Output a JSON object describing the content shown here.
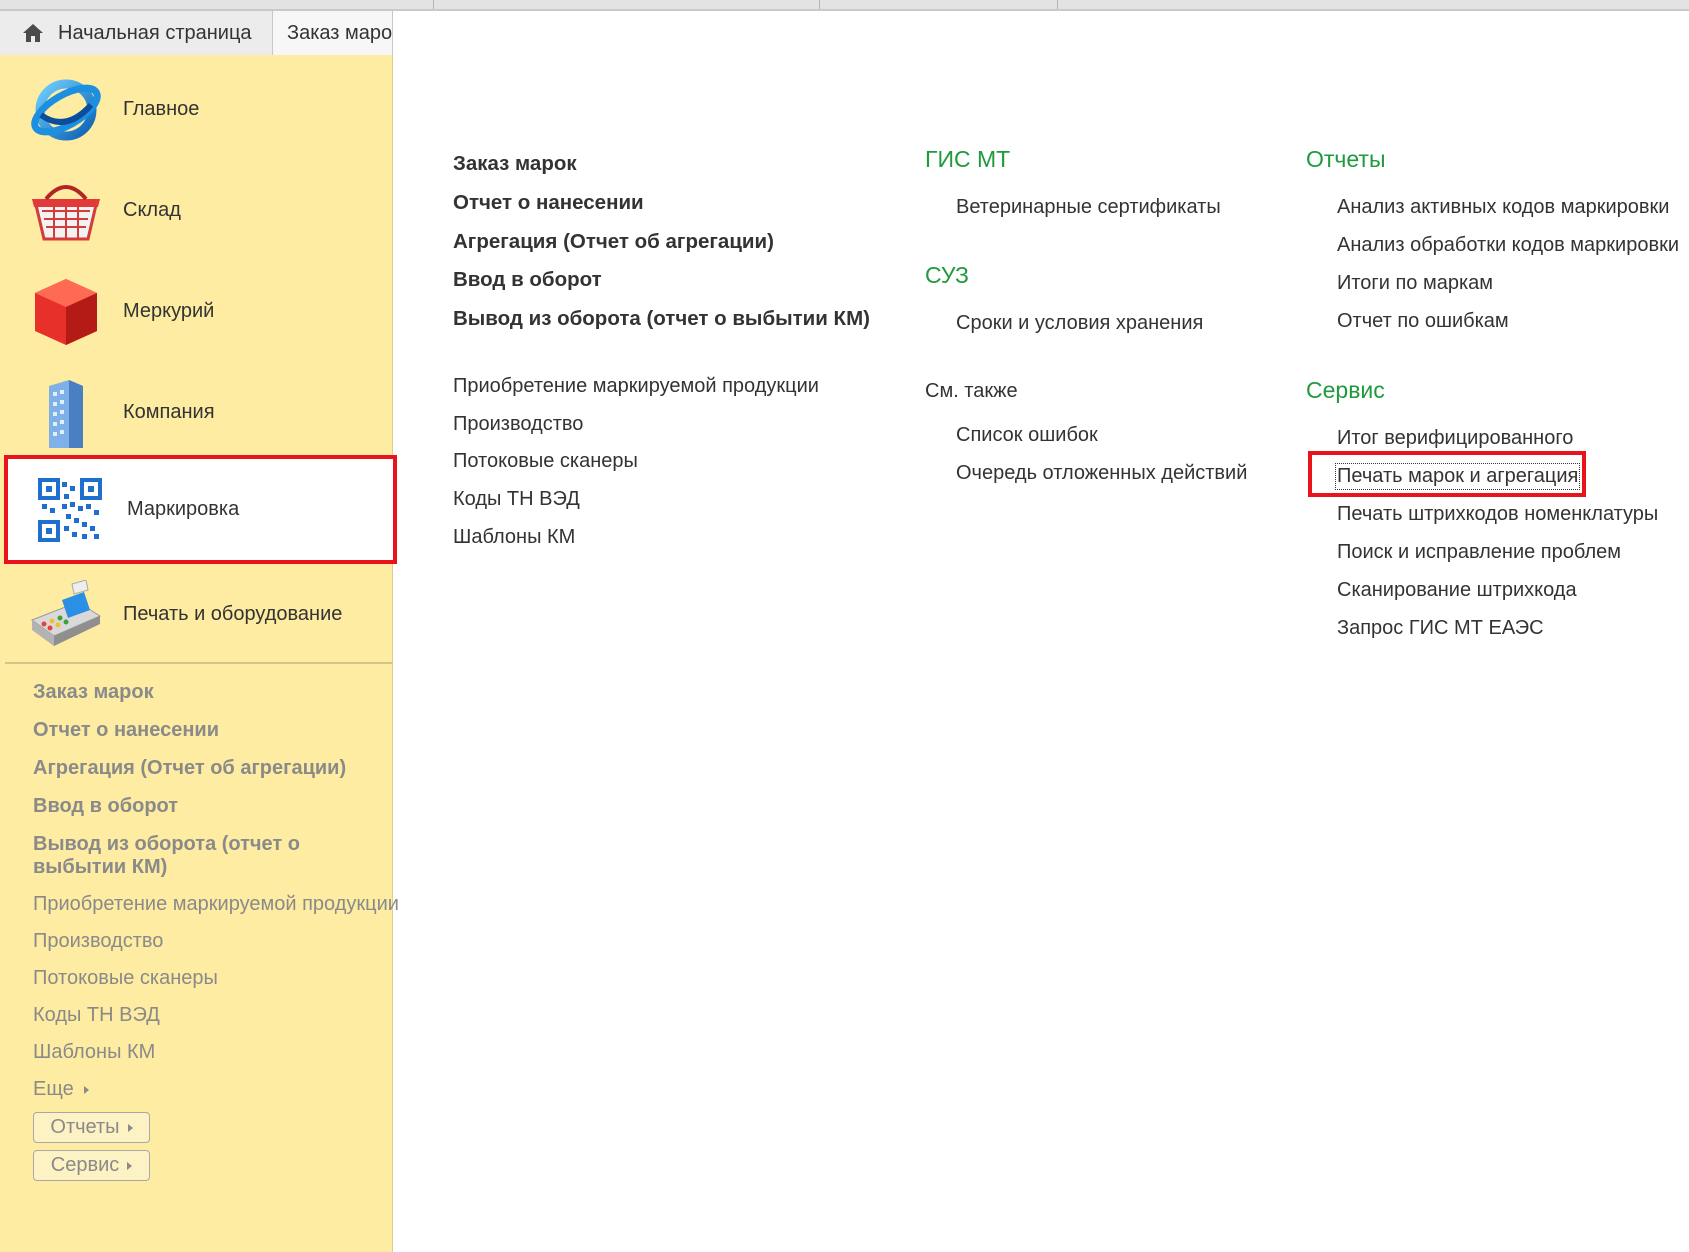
{
  "tabs": {
    "home": "Начальная страница",
    "order": "Заказ маро"
  },
  "sections": [
    {
      "label": "Главное",
      "icon": "globe-icon"
    },
    {
      "label": "Склад",
      "icon": "basket-icon"
    },
    {
      "label": "Меркурий",
      "icon": "red-cube-icon"
    },
    {
      "label": "Компания",
      "icon": "building-icon"
    },
    {
      "label": "Маркировка",
      "icon": "qr-code-icon"
    },
    {
      "label": "Печать и оборудование",
      "icon": "pos-terminal-icon"
    }
  ],
  "sidebar_links": [
    "Заказ марок",
    "Отчет о нанесении",
    "Агрегация (Отчет об агрегации)",
    "Ввод в оборот",
    "Вывод из оборота (отчет о выбытии КМ)",
    "Приобретение маркируемой продукции",
    "Производство",
    "Потоковые сканеры",
    "Коды ТН ВЭД",
    "Шаблоны КМ"
  ],
  "sidebar_more": "Еще",
  "sidebar_buttons": [
    "Отчеты",
    "Сервис"
  ],
  "col1": {
    "main": [
      "Заказ марок",
      "Отчет о нанесении",
      "Агрегация (Отчет об агрегации)",
      "Ввод в оборот",
      "Вывод из оборота (отчет о выбытии КМ)"
    ],
    "other": [
      "Приобретение маркируемой продукции",
      "Производство",
      "Потоковые сканеры",
      "Коды ТН ВЭД",
      "Шаблоны КМ"
    ]
  },
  "col2": {
    "gis_header": "ГИС МТ",
    "gis_items": [
      "Ветеринарные сертификаты"
    ],
    "suz_header": "СУЗ",
    "suz_items": [
      "Сроки и условия хранения"
    ],
    "see_also_header": "См. также",
    "see_also_items": [
      "Список ошибок",
      "Очередь отложенных действий"
    ]
  },
  "col3": {
    "reports_header": "Отчеты",
    "reports_items": [
      "Анализ активных кодов маркировки",
      "Анализ обработки кодов маркировки",
      "Итоги по маркам",
      "Отчет по ошибкам"
    ],
    "service_header": "Сервис",
    "service_items": [
      "Итог верифицированного",
      "Печать марок и агрегация",
      "Печать штрихкодов номенклатуры",
      "Поиск и исправление проблем",
      "Сканирование штрихкода",
      "Запрос ГИС МТ ЕАЭС"
    ]
  },
  "colors": {
    "sidebar_bg": "#fdeca1",
    "header_green": "#1f9a3c",
    "highlight_red": "#e8131b"
  }
}
